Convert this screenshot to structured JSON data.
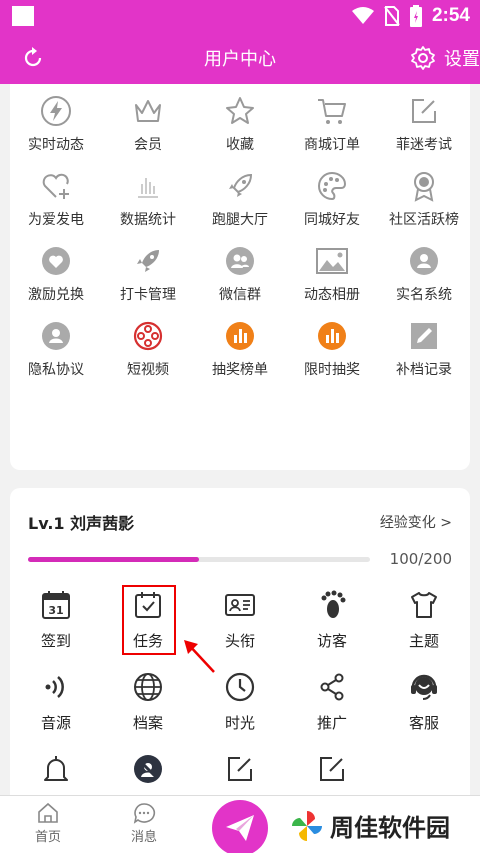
{
  "status_bar": {
    "time": "2:54"
  },
  "header": {
    "title": "用户中心",
    "settings_label": "设置"
  },
  "menu": {
    "items": [
      {
        "label": "实时动态",
        "icon": "lightning-icon"
      },
      {
        "label": "会员",
        "icon": "crown-icon"
      },
      {
        "label": "收藏",
        "icon": "star-icon"
      },
      {
        "label": "商城订单",
        "icon": "cart-icon"
      },
      {
        "label": "菲迷考试",
        "icon": "edit-icon"
      },
      {
        "label": "为爱发电",
        "icon": "heart-plus-icon"
      },
      {
        "label": "数据统计",
        "icon": "bar-chart-icon"
      },
      {
        "label": "跑腿大厅",
        "icon": "rocket-icon"
      },
      {
        "label": "同城好友",
        "icon": "palette-icon"
      },
      {
        "label": "社区活跃榜",
        "icon": "medal-icon"
      },
      {
        "label": "激励兑换",
        "icon": "heart-circle-icon"
      },
      {
        "label": "打卡管理",
        "icon": "rocket-icon"
      },
      {
        "label": "微信群",
        "icon": "group-icon"
      },
      {
        "label": "动态相册",
        "icon": "image-icon"
      },
      {
        "label": "实名系统",
        "icon": "user-circle-icon"
      },
      {
        "label": "隐私协议",
        "icon": "user-circle-icon"
      },
      {
        "label": "短视频",
        "icon": "film-reel-icon"
      },
      {
        "label": "抽奖榜单",
        "icon": "chart-circle-icon"
      },
      {
        "label": "限时抽奖",
        "icon": "chart-circle-icon"
      },
      {
        "label": "补档记录",
        "icon": "pencil-square-icon"
      }
    ]
  },
  "level": {
    "title": "Lv.1 刘声茜影",
    "exp_link": "经验变化 >",
    "progress_text": "100/200",
    "progress_fraction": 0.5
  },
  "tools": {
    "items": [
      {
        "label": "签到",
        "icon": "calendar-31-icon"
      },
      {
        "label": "任务",
        "icon": "calendar-check-icon"
      },
      {
        "label": "头衔",
        "icon": "id-card-icon"
      },
      {
        "label": "访客",
        "icon": "footprint-icon"
      },
      {
        "label": "主题",
        "icon": "shirt-icon"
      },
      {
        "label": "音源",
        "icon": "sound-wave-icon"
      },
      {
        "label": "档案",
        "icon": "globe-icon"
      },
      {
        "label": "时光",
        "icon": "clock-icon"
      },
      {
        "label": "推广",
        "icon": "share-icon"
      },
      {
        "label": "客服",
        "icon": "headset-icon"
      },
      {
        "label": "",
        "icon": "bell-icon"
      },
      {
        "label": "",
        "icon": "user-blocked-icon"
      },
      {
        "label": "",
        "icon": "edit-icon"
      },
      {
        "label": "",
        "icon": "edit-icon"
      }
    ]
  },
  "bottom_nav": {
    "home_label": "首页",
    "messages_label": "消息"
  },
  "watermark": {
    "text": "周佳软件园"
  },
  "colors": {
    "brand": "#e234c8",
    "highlight": "#e00000",
    "icon_gray": "#9a9a9a",
    "icon_orange": "#f08018",
    "icon_red": "#d63030"
  }
}
